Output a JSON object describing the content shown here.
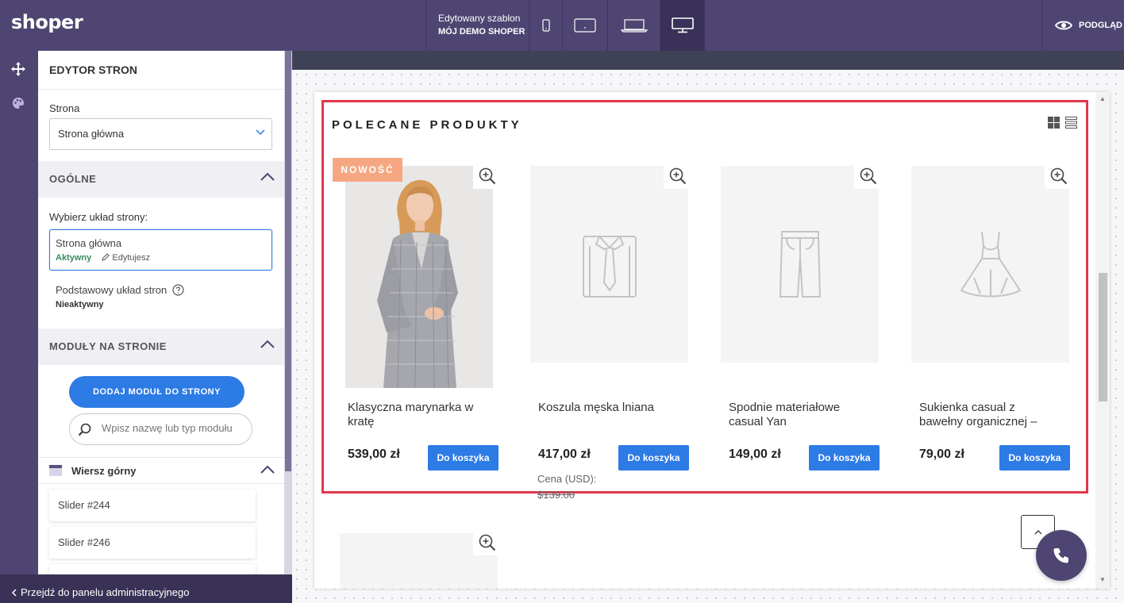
{
  "app": {
    "logo": "shoper",
    "template_label": "Edytowany szablon",
    "template_name": "MÓJ DEMO SHOPER",
    "preview_label": "PODGLĄD",
    "devices": [
      "mobile-icon",
      "tablet-icon",
      "laptop-icon",
      "desktop-icon"
    ],
    "active_device": "desktop-icon"
  },
  "rail": {
    "icons": [
      "move-icon",
      "palette-icon"
    ]
  },
  "panel": {
    "title": "EDYTOR STRON",
    "page_label": "Strona",
    "page_value": "Strona główna",
    "general": {
      "heading": "OGÓLNE",
      "layout_label": "Wybierz układ strony:",
      "layouts": [
        {
          "name": "Strona główna",
          "status": "Aktywny",
          "edit": "Edytujesz"
        },
        {
          "name": "Podstawowy układ stron",
          "status": "Nieaktywny"
        }
      ]
    },
    "modules": {
      "heading": "MODUŁY NA STRONIE",
      "add_button": "DODAJ MODUŁ DO STRONY",
      "search_placeholder": "Wpisz nazwę lub typ modułu",
      "row_title": "Wiersz górny",
      "items": [
        "Slider #244",
        "Slider #246"
      ]
    }
  },
  "footer": {
    "back_link": "Przejdź do panelu administracyjnego"
  },
  "preview": {
    "section_title": "POLECANE PRODUKTY",
    "products": [
      {
        "name": "Klasyczna marynarka w kratę",
        "price": "539,00 zł",
        "cart": "Do koszyka",
        "badge": "NOWOŚĆ",
        "image": "woman-in-plaid-blazer"
      },
      {
        "name": "Koszula męska lniana",
        "price": "417,00 zł",
        "cart": "Do koszyka",
        "image": "shirt-icon",
        "usd_label": "Cena (USD):",
        "usd_value": "$139.00"
      },
      {
        "name": "Spodnie materiałowe casual Yan",
        "price": "149,00 zł",
        "cart": "Do koszyka",
        "image": "trousers-icon"
      },
      {
        "name": "Sukienka casual z bawełny organicznej –",
        "price": "79,00 zł",
        "cart": "Do koszyka",
        "image": "dress-icon"
      }
    ]
  },
  "colors": {
    "brand": "#4e4572",
    "accent": "#2d7be5",
    "selection": "#e2364a",
    "badge": "#f6a781"
  }
}
